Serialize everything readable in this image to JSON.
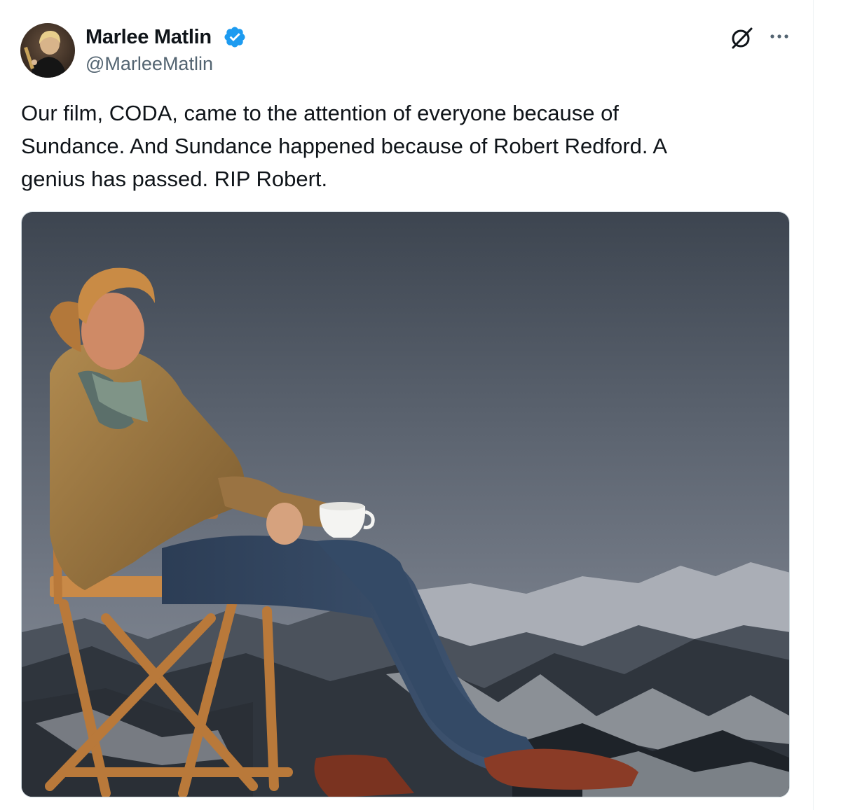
{
  "author": {
    "name": "Marlee Matlin",
    "handle": "@MarleeMatlin",
    "verified": true
  },
  "icons": {
    "avatar": "avatar-photo",
    "verified": "verified-badge-icon",
    "grok": "grok-icon",
    "more": "more-options-icon"
  },
  "tweet": {
    "text": "Our film, CODA, came to the attention of everyone because of\nSundance. And Sundance happened because of Robert Redford.  A\ngenius has passed. RIP Robert."
  },
  "colors": {
    "verified_blue": "#1d9bf0",
    "handle_gray": "#536471",
    "text": "#0f1419"
  }
}
